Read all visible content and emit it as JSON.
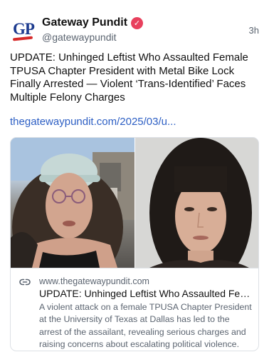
{
  "post": {
    "author": {
      "name": "Gateway Pundit",
      "handle": "@gatewaypundit",
      "avatar_text": "GP",
      "verified": true
    },
    "time": "3h",
    "text": "UPDATE: Unhinged Leftist Who Assaulted Female TPUSA Chapter President with Metal Bike Lock Finally Arrested — Violent ‘Trans-Identified’ Faces Multiple Felony Charges",
    "link_text": "thegatewaypundit.com/2025/03/u...",
    "embed": {
      "domain": "www.thegatewaypundit.com",
      "title": "UPDATE: Unhinged Leftist Who Assaulted Fem...",
      "description": "A violent attack on a female TPUSA Chapter President at the University of Texas at Dallas has led to the arrest of the assailant, revealing serious charges and raising concerns about escalating political violence."
    }
  },
  "colors": {
    "link": "#2d5fc4",
    "verified_badge": "#e8405d",
    "avatar_blue": "#1d3b8f",
    "avatar_red": "#d62a2a",
    "muted_text": "#5b6470"
  },
  "icons": {
    "verified": "check-badge",
    "link": "chain-link"
  }
}
